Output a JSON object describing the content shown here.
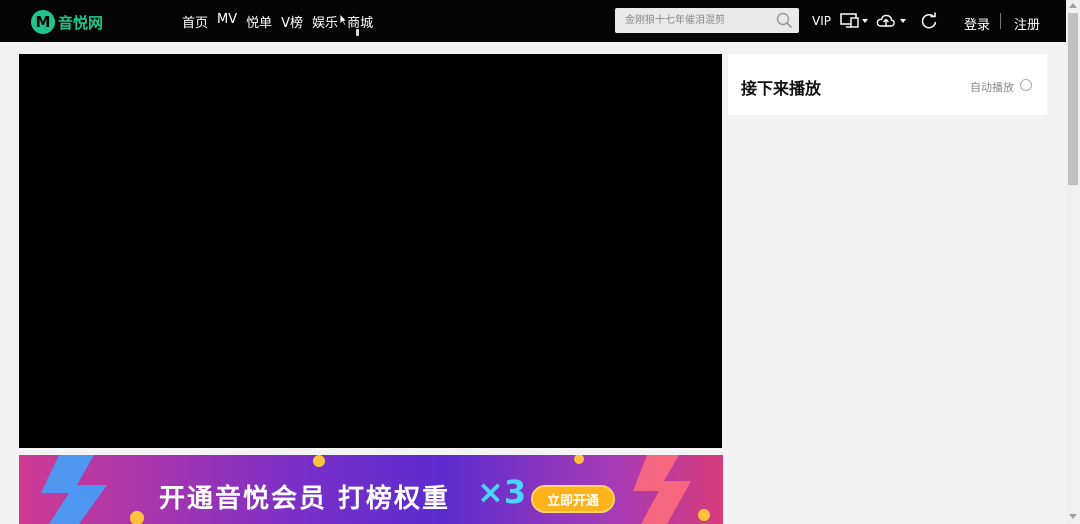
{
  "brand": {
    "logo_letter": "M",
    "name": "音悦网",
    "color": "#1fc58c"
  },
  "nav": [
    {
      "label": "首页"
    },
    {
      "label": "MV"
    },
    {
      "label": "悦单"
    },
    {
      "label": "V榜"
    },
    {
      "label": "娱乐"
    },
    {
      "label": "商城"
    }
  ],
  "search": {
    "placeholder": "金刚狼十七年催泪混剪"
  },
  "header": {
    "vip": "VIP",
    "login": "登录",
    "register": "注册",
    "icons": [
      "monitor-icon",
      "cloud-icon",
      "refresh-icon"
    ]
  },
  "upnext": {
    "title": "接下来播放",
    "autoplay_label": "自动播放"
  },
  "banner": {
    "text": "开通音悦会员  打榜权重",
    "multiplier": "×3",
    "button": "立即开通"
  },
  "colors": {
    "topbar": "#050505",
    "accent": "#1fc58c",
    "banner_button": "#ffb21c"
  }
}
